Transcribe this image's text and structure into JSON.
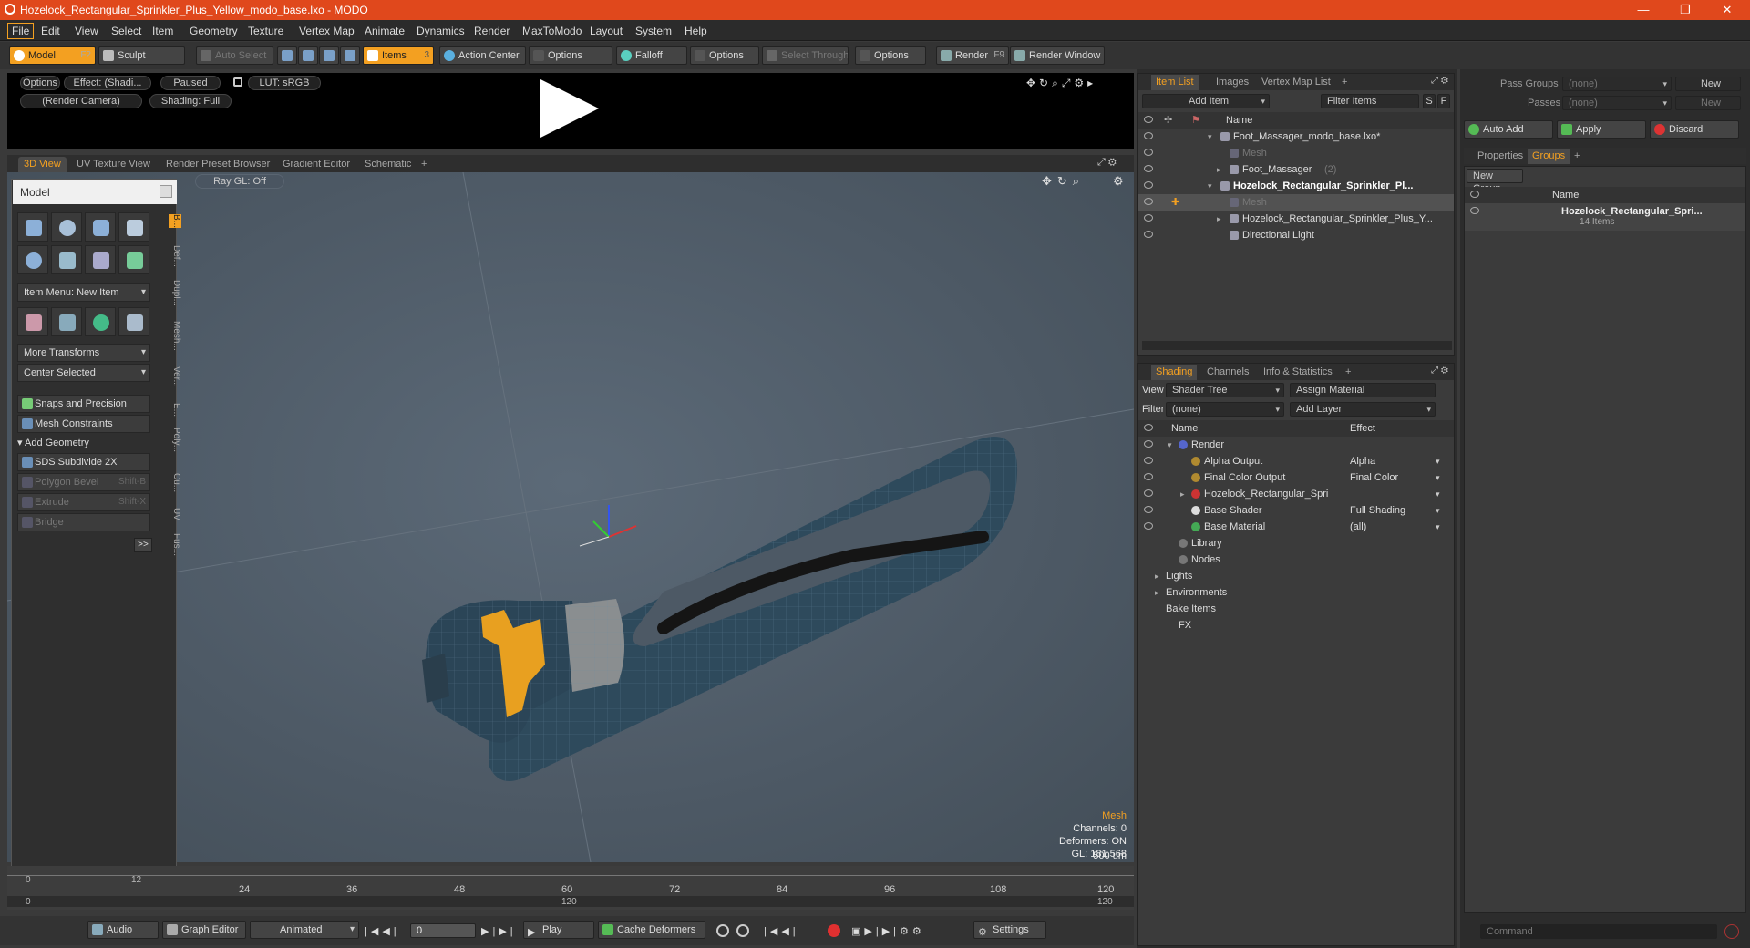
{
  "window": {
    "title": "Hozelock_Rectangular_Sprinkler_Plus_Yellow_modo_base.lxo - MODO",
    "min": "—",
    "max": "❐",
    "close": "✕"
  },
  "menu": [
    "File",
    "Edit",
    "View",
    "Select",
    "Item",
    "Geometry",
    "Texture",
    "Vertex Map",
    "Animate",
    "Dynamics",
    "Render",
    "MaxToModo",
    "Layout",
    "System",
    "Help"
  ],
  "toolbar": {
    "model": "Model",
    "model_key": "F2",
    "sculpt": "Sculpt",
    "auto_select": "Auto Select",
    "items": "Items",
    "items_key": "3",
    "action_center": "Action Center",
    "options1": "Options",
    "falloff": "Falloff",
    "options2": "Options",
    "select_through": "Select Through",
    "options3": "Options",
    "render": "Render",
    "render_key": "F9",
    "render_window": "Render Window"
  },
  "preview": {
    "options": "Options",
    "effect": "Effect: (Shadi...",
    "paused": "Paused",
    "lut": "LUT: sRGB",
    "camera": "(Render Camera)",
    "shading": "Shading: Full"
  },
  "viewtabs": [
    "3D View",
    "UV Texture View",
    "Render Preset Browser",
    "Gradient Editor",
    "Schematic",
    "+"
  ],
  "viewport": {
    "raygl": "Ray GL: Off",
    "hud": {
      "type": "Mesh",
      "channels": "Channels: 0",
      "deformers": "Deformers: ON",
      "gl": "GL: 181,568",
      "scale": "500 um"
    }
  },
  "modelpanel": {
    "title": "Model",
    "item_menu": "Item Menu: New Item",
    "more_transforms": "More Transforms",
    "center_selected": "Center Selected",
    "snaps": "Snaps and Precision",
    "mesh_constraints": "Mesh Constraints",
    "add_geometry": "Add Geometry",
    "sds": "SDS Subdivide 2X",
    "polygon_bevel": "Polygon Bevel",
    "polygon_bevel_key": "Shift-B",
    "extrude": "Extrude",
    "extrude_key": "Shift-X",
    "bridge": "Bridge",
    "more": ">>",
    "vtabs": [
      "B...",
      "Def...",
      "Dupl...",
      "Mesh...",
      "Ver...",
      "E...",
      "Poly...",
      "Cu...",
      "UV",
      "Fus..."
    ]
  },
  "timeline": {
    "ticks": [
      "0",
      "12",
      "24",
      "36",
      "48",
      "60",
      "72",
      "84",
      "96",
      "108",
      "120"
    ],
    "bottom": [
      "0",
      "120",
      "120"
    ]
  },
  "bottombar": {
    "audio": "Audio",
    "graph_editor": "Graph Editor",
    "animated": "Animated",
    "frame": "0",
    "play": "Play",
    "cache_deformers": "Cache Deformers",
    "settings": "Settings"
  },
  "itemlist": {
    "tabs": [
      "Item List",
      "Images",
      "Vertex Map List",
      "+"
    ],
    "add_item": "Add Item",
    "filter_items": "Filter Items",
    "s": "S",
    "f": "F",
    "col_name": "Name",
    "rows": [
      {
        "label": "Foot_Massager_modo_base.lxo*",
        "indent": 1,
        "dim": false,
        "bold": false
      },
      {
        "label": "Mesh",
        "indent": 2,
        "dim": true,
        "bold": false
      },
      {
        "label": "Foot_Massager",
        "suffix": "(2)",
        "indent": 2,
        "dim": false,
        "bold": false
      },
      {
        "label": "Hozelock_Rectangular_Sprinkler_Pl...",
        "indent": 1,
        "dim": false,
        "bold": true
      },
      {
        "label": "Mesh",
        "indent": 2,
        "dim": true,
        "bold": false
      },
      {
        "label": "Hozelock_Rectangular_Sprinkler_Plus_Y...",
        "indent": 2,
        "dim": false,
        "bold": false
      },
      {
        "label": "Directional Light",
        "indent": 2,
        "dim": false,
        "bold": false
      }
    ]
  },
  "shading": {
    "tabs": [
      "Shading",
      "Channels",
      "Info & Statistics",
      "+"
    ],
    "view_label": "View",
    "view": "Shader Tree",
    "assign_material": "Assign Material",
    "filter_label": "Filter",
    "filter": "(none)",
    "add_layer": "Add Layer",
    "col_name": "Name",
    "col_effect": "Effect",
    "rows": [
      {
        "label": "Render",
        "effect": ""
      },
      {
        "label": "Alpha Output",
        "effect": "Alpha"
      },
      {
        "label": "Final Color Output",
        "effect": "Final Color"
      },
      {
        "label": "Hozelock_Rectangular_Spri",
        "effect": ""
      },
      {
        "label": "Base Shader",
        "effect": "Full Shading"
      },
      {
        "label": "Base Material",
        "effect": "(all)"
      },
      {
        "label": "Library",
        "effect": ""
      },
      {
        "label": "Nodes",
        "effect": ""
      },
      {
        "label": "Lights",
        "effect": ""
      },
      {
        "label": "Environments",
        "effect": ""
      },
      {
        "label": "Bake Items",
        "effect": ""
      },
      {
        "label": "FX",
        "effect": ""
      }
    ]
  },
  "groups": {
    "pass_groups": "Pass Groups",
    "none1": "(none)",
    "new1": "New",
    "passes": "Passes",
    "none2": "(none)",
    "new2": "New",
    "auto_add": "Auto Add",
    "apply": "Apply",
    "discard": "Discard",
    "tabs": [
      "Properties",
      "Groups",
      "+"
    ],
    "new_group": "New Group",
    "col_name": "Name",
    "group_name": "Hozelock_Rectangular_Spri...",
    "group_count": "14 Items",
    "command": "Command"
  }
}
